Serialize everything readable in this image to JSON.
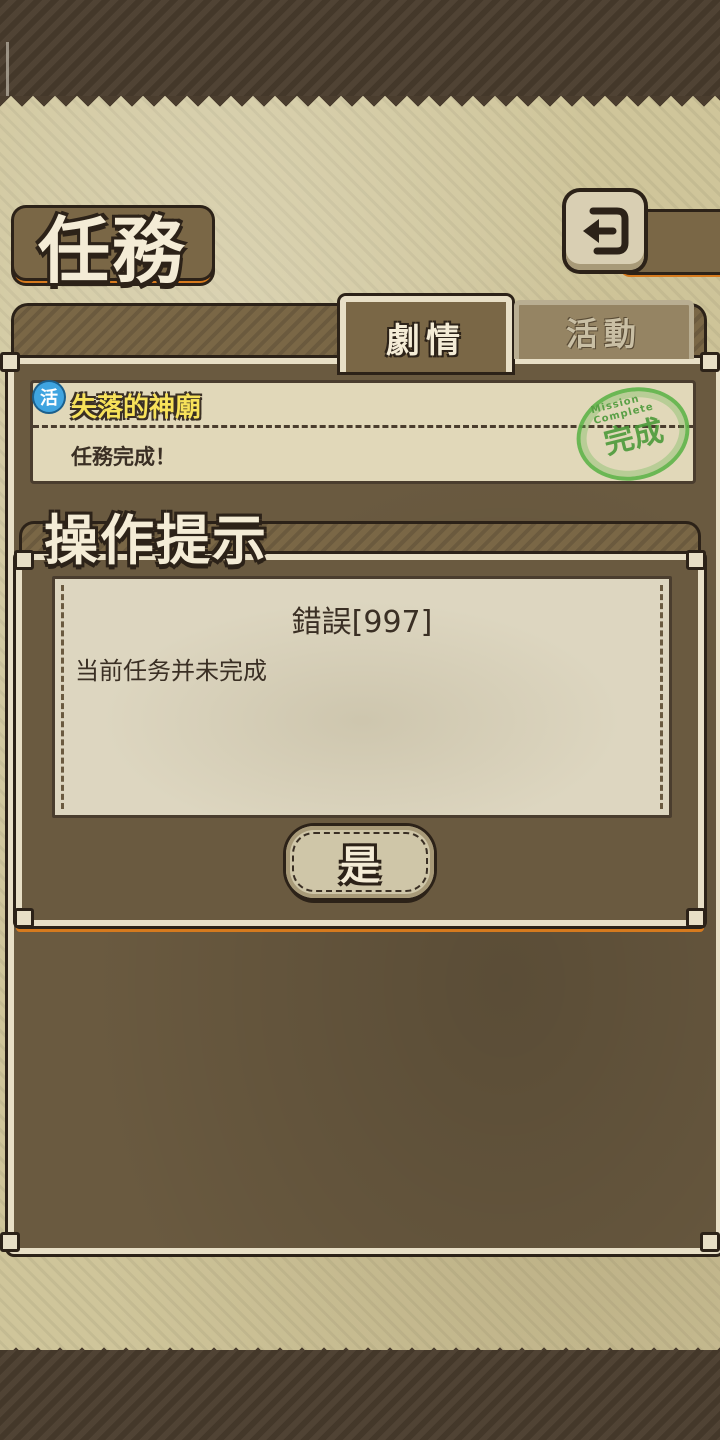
{
  "header": {
    "title": "任務",
    "back_icon": "back-arrow-icon"
  },
  "tabs": [
    {
      "label": "劇情",
      "active": true
    },
    {
      "label": "活動",
      "active": false
    }
  ],
  "quest": {
    "badge": "活",
    "title": "失落的神廟",
    "status": "任務完成！",
    "stamp_text": "完成",
    "stamp_ring": "Mission Complete"
  },
  "dialog": {
    "title": "操作提示",
    "error": "錯誤[997]",
    "message": "当前任务并未完成",
    "confirm_label": "是"
  },
  "colors": {
    "accent_orange": "#d67a1e",
    "stamp_green": "#5fb44a",
    "quest_title_yellow": "#f7e25a",
    "frame_light": "#e8dfc6"
  }
}
